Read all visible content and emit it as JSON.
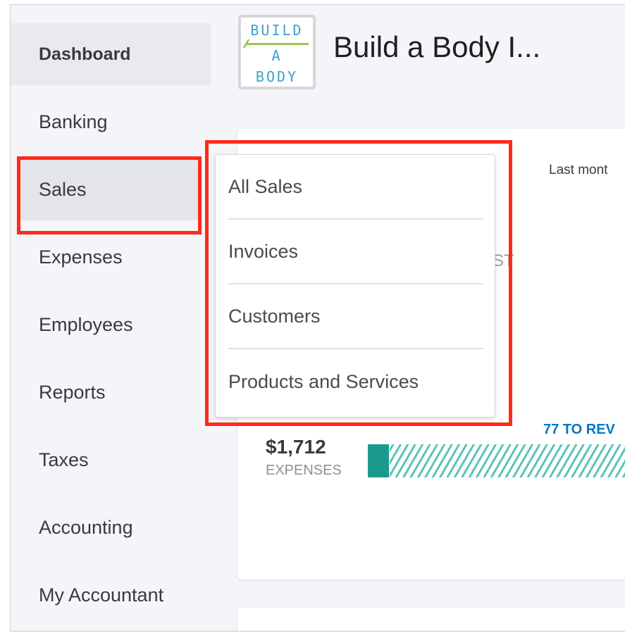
{
  "sidebar": {
    "items": [
      {
        "label": "Dashboard"
      },
      {
        "label": "Banking"
      },
      {
        "label": "Sales"
      },
      {
        "label": "Expenses"
      },
      {
        "label": "Employees"
      },
      {
        "label": "Reports"
      },
      {
        "label": "Taxes"
      },
      {
        "label": "Accounting"
      },
      {
        "label": "My Accountant"
      }
    ]
  },
  "header": {
    "logo_line1": "BUILD",
    "logo_line2": "A",
    "logo_line3": "BODY",
    "company_name": "Build a Body I..."
  },
  "dashboard": {
    "period": "Last mont",
    "behind_text": "ST",
    "expenses_amount": "$1,712",
    "expenses_label": "EXPENSES",
    "review_link": "77 TO REV"
  },
  "sales_menu": {
    "items": [
      {
        "label": "All Sales"
      },
      {
        "label": "Invoices"
      },
      {
        "label": "Customers"
      },
      {
        "label": "Products and Services"
      }
    ]
  },
  "colors": {
    "highlight": "#ff2a1a",
    "bar_teal": "#1a9a8c",
    "link_blue": "#0077c5"
  }
}
